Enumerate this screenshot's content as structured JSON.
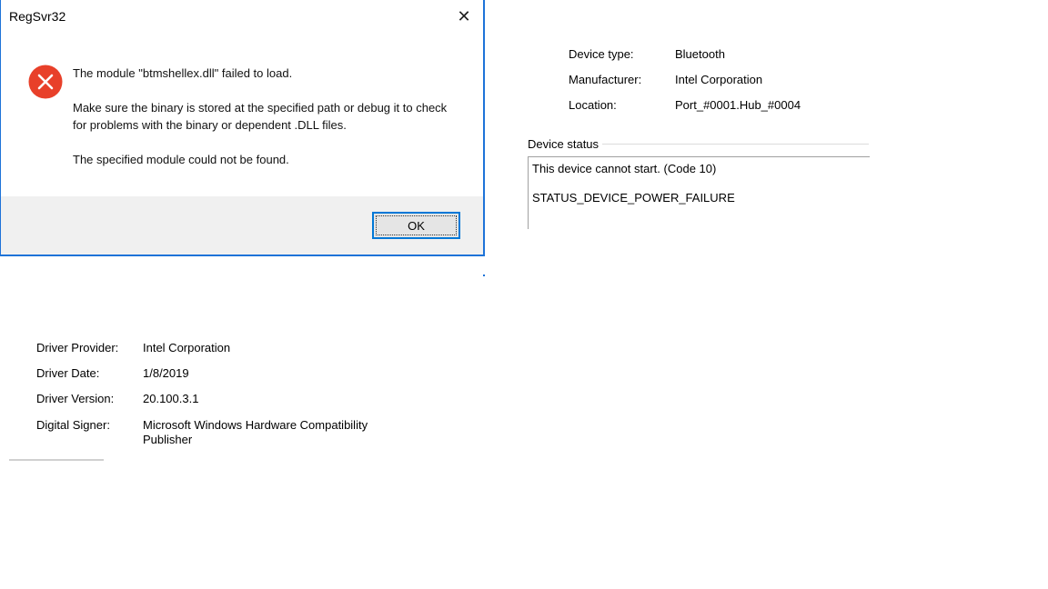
{
  "dialog": {
    "title": "RegSvr32",
    "close_glyph": "✕",
    "icon": "error-icon",
    "message_line1": "The module \"btmshellex.dll\" failed to load.",
    "message_line2": "Make sure the binary is stored at the specified path or debug it to check for problems with the binary or dependent .DLL files.",
    "message_line3": "The specified module could not be found.",
    "ok_label": "OK",
    "accent_color": "#1e73d8",
    "error_color": "#e8402a"
  },
  "device": {
    "type_label": "Device type:",
    "type_value": "Bluetooth",
    "manufacturer_label": "Manufacturer:",
    "manufacturer_value": "Intel Corporation",
    "location_label": "Location:",
    "location_value": "Port_#0001.Hub_#0004",
    "status_heading": "Device status",
    "status_line1": "This device cannot start. (Code 10)",
    "status_line2": "STATUS_DEVICE_POWER_FAILURE"
  },
  "driver": {
    "provider_label": "Driver Provider:",
    "provider_value": "Intel Corporation",
    "date_label": "Driver Date:",
    "date_value": "1/8/2019",
    "version_label": "Driver Version:",
    "version_value": "20.100.3.1",
    "signer_label": "Digital Signer:",
    "signer_value": "Microsoft Windows Hardware Compatibility Publisher"
  }
}
